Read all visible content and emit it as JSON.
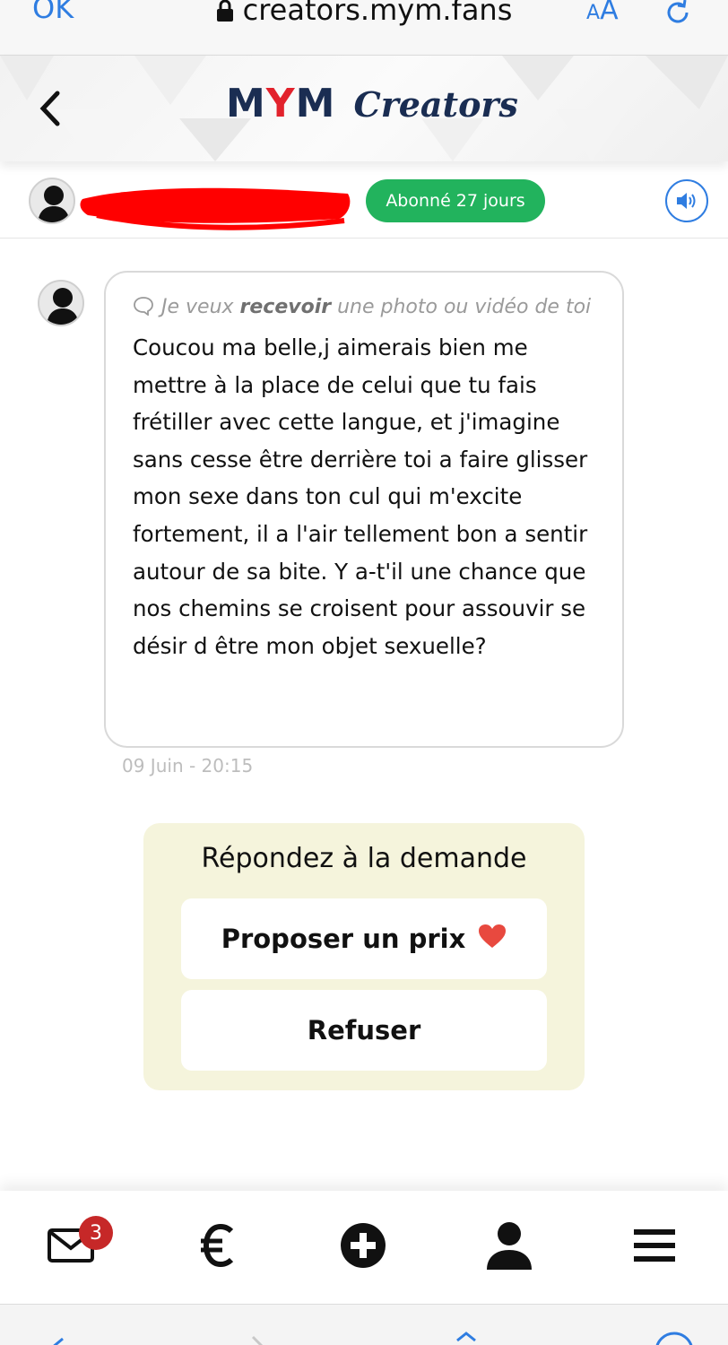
{
  "browser": {
    "done_label": "OK",
    "url": "creators.mym.fans",
    "text_size_label_small": "A",
    "text_size_label_large": "A"
  },
  "header": {
    "logo_primary_m1": "M",
    "logo_primary_y": "Y",
    "logo_primary_m2": "M",
    "logo_secondary": "Creators"
  },
  "conversation": {
    "subscription_badge": "Abonné 27 jours"
  },
  "message": {
    "request_prefix": "Je veux ",
    "request_bold": "recevoir",
    "request_suffix": " une photo ou vidéo de toi",
    "body": "Coucou ma belle,j aimerais bien me mettre à la place de celui que tu fais frétiller avec cette langue, et j'imagine sans cesse être derrière toi a faire glisser mon sexe dans ton cul qui m'excite fortement, il a l'air tellement bon a sentir autour de sa bite. Y a-t'il une chance que nos chemins se croisent pour assouvir se désir d être mon objet sexuelle?",
    "timestamp": "09 Juin - 20:15"
  },
  "response_panel": {
    "title": "Répondez à la demande",
    "propose_label": "Proposer un prix",
    "refuse_label": "Refuser"
  },
  "tabbar": {
    "messages_badge": "3",
    "items": [
      "messages-icon",
      "euro-icon",
      "plus-circle-icon",
      "user-icon",
      "menu-icon"
    ]
  },
  "colors": {
    "accent_blue": "#2f7de1",
    "badge_green": "#22b35d",
    "brand_navy": "#1a2d52",
    "brand_red": "#e2222c",
    "panel_bg": "#f5f4dc",
    "heart_red": "#e8493f"
  }
}
